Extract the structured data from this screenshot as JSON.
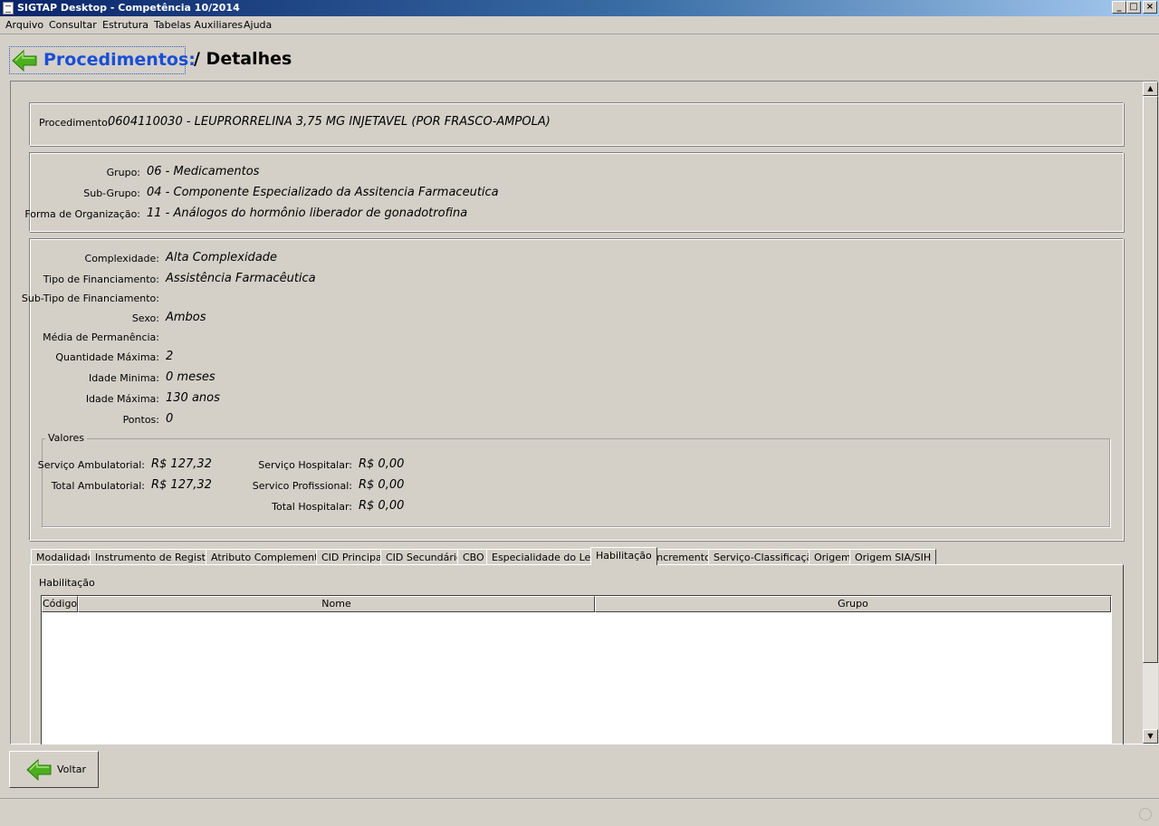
{
  "window": {
    "title": "SIGTAP Desktop - Competência 10/2014",
    "buttons": [
      "_",
      "□",
      "×"
    ]
  },
  "menu": [
    "Arquivo",
    "Consultar",
    "Estrutura",
    "Tabelas Auxiliares",
    "Ajuda"
  ],
  "header": {
    "link": "Procedimentos:",
    "title": "/ Detalhes",
    "back_icon": "green-left-arrow-icon"
  },
  "procedure": {
    "label": "Procedimento:",
    "value": "0604110030 - LEUPRORRELINA 3,75 MG INJETAVEL (POR FRASCO-AMPOLA)"
  },
  "classification": [
    {
      "label": "Grupo:",
      "value": "06 - Medicamentos"
    },
    {
      "label": "Sub-Grupo:",
      "value": "04 - Componente Especializado da Assitencia Farmaceutica"
    },
    {
      "label": "Forma de Organização:",
      "value": "11 - Análogos do hormônio liberador de gonadotrofina"
    }
  ],
  "details": [
    {
      "label": "Complexidade:",
      "value": "Alta Complexidade"
    },
    {
      "label": "Tipo de Financiamento:",
      "value": "Assistência Farmacêutica"
    },
    {
      "label": "Sub-Tipo de Financiamento:",
      "value": ""
    },
    {
      "label": "Sexo:",
      "value": "Ambos"
    },
    {
      "label": "Média de Permanência:",
      "value": ""
    },
    {
      "label": "Quantidade Máxima:",
      "value": "2"
    },
    {
      "label": "Idade Minima:",
      "value": "0 meses"
    },
    {
      "label": "Idade Máxima:",
      "value": "130 anos"
    },
    {
      "label": "Pontos:",
      "value": "0"
    }
  ],
  "valores": {
    "legend": "Valores",
    "left": [
      {
        "label": "Serviço Ambulatorial:",
        "value": "R$ 127,32"
      },
      {
        "label": "Total Ambulatorial:",
        "value": "R$ 127,32"
      }
    ],
    "right": [
      {
        "label": "Serviço Hospitalar:",
        "value": "R$ 0,00"
      },
      {
        "label": "Servico Profissional:",
        "value": "R$ 0,00"
      },
      {
        "label": "Total Hospitalar:",
        "value": "R$ 0,00"
      }
    ]
  },
  "tabs": [
    "Modalidade",
    "Instrumento de Registro",
    "Atributo Complementar",
    "CID Principal",
    "CID Secundário",
    "CBO",
    "Especialidade do Leito",
    "Habilitação",
    "Incremento",
    "Serviço-Classificação",
    "Origem",
    "Origem SIA/SIH"
  ],
  "active_tab": "Habilitação",
  "tab_panel": {
    "title": "Habilitação",
    "columns": [
      "Código",
      "Nome",
      "Grupo"
    ],
    "rows": []
  },
  "footer": {
    "back_button": "Voltar"
  },
  "colors": {
    "face": "#d4d0c8",
    "link": "#1a4fd6",
    "arrow": "#4caf1e"
  }
}
